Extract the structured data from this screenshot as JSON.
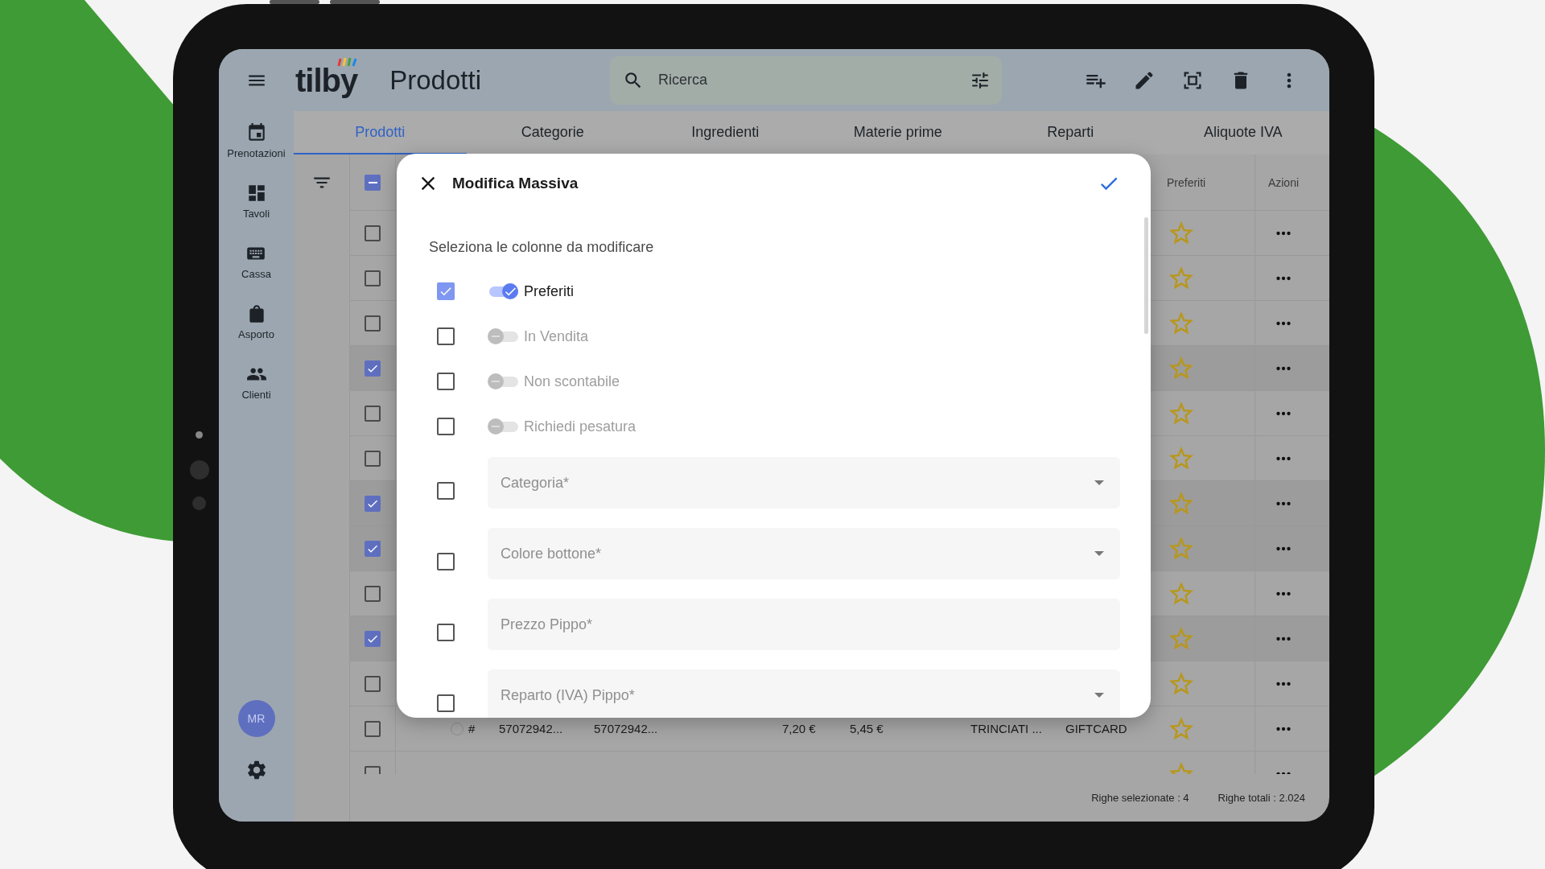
{
  "topbar": {
    "logo": "tilby",
    "title": "Prodotti",
    "search": {
      "placeholder": "Ricerca"
    }
  },
  "sidebar": {
    "items": [
      {
        "label": "Prenotazioni"
      },
      {
        "label": "Tavoli"
      },
      {
        "label": "Cassa"
      },
      {
        "label": "Asporto"
      },
      {
        "label": "Clienti"
      }
    ],
    "avatar": "MR"
  },
  "tabs": [
    {
      "label": "Prodotti",
      "selected": true
    },
    {
      "label": "Categorie",
      "selected": false
    },
    {
      "label": "Ingredienti",
      "selected": false
    },
    {
      "label": "Materie prime",
      "selected": false
    },
    {
      "label": "Reparti",
      "selected": false
    },
    {
      "label": "Aliquote IVA",
      "selected": false
    }
  ],
  "table": {
    "select_all": {
      "indeterminate": true
    },
    "columns": [
      "Preferiti",
      "Azioni"
    ],
    "rows": [
      {
        "checked": false
      },
      {
        "checked": false
      },
      {
        "checked": false
      },
      {
        "checked": true
      },
      {
        "checked": false
      },
      {
        "checked": false
      },
      {
        "checked": true
      },
      {
        "checked": true
      },
      {
        "checked": false
      },
      {
        "checked": true
      },
      {
        "checked": false
      },
      {
        "checked": false,
        "radio_selected": false,
        "cells": [
          "#",
          "57072942...",
          "57072942...",
          "7,20 €",
          "5,45 €",
          "TRINCIATI ...",
          "GIFTCARD"
        ]
      },
      {
        "checked": false
      }
    ]
  },
  "footer": {
    "selected": "Righe selezionate : 4",
    "total": "Righe totali : 2.024"
  },
  "dialog": {
    "title": "Modifica Massiva",
    "subtitle": "Seleziona le colonne da modificare",
    "fields": [
      {
        "kind": "toggle",
        "label": "Preferiti",
        "checked": true,
        "on": true,
        "disabled": false
      },
      {
        "kind": "toggle",
        "label": "In Vendita",
        "checked": false,
        "on": false,
        "disabled": true
      },
      {
        "kind": "toggle",
        "label": "Non scontabile",
        "checked": false,
        "on": false,
        "disabled": true
      },
      {
        "kind": "toggle",
        "label": "Richiedi pesatura",
        "checked": false,
        "on": false,
        "disabled": true
      },
      {
        "kind": "select",
        "placeholder": "Categoria*",
        "checked": false
      },
      {
        "kind": "select",
        "placeholder": "Colore bottone*",
        "checked": false
      },
      {
        "kind": "text",
        "placeholder": "Prezzo Pippo*",
        "checked": false
      },
      {
        "kind": "select",
        "placeholder": "Reparto (IVA) Pippo*",
        "checked": false
      }
    ]
  }
}
